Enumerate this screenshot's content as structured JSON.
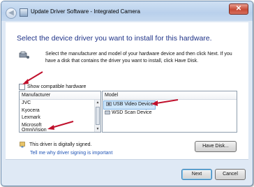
{
  "window": {
    "title": "Update Driver Software - Integrated Camera",
    "close_glyph": "✕",
    "back_glyph": "◀"
  },
  "content": {
    "heading": "Select the device driver you want to install for this hardware.",
    "instructions": "Select the manufacturer and model of your hardware device and then click Next. If you have a disk that contains the driver you want to install, click Have Disk.",
    "compatible_checkbox": {
      "label": "Show compatible hardware",
      "checked": false
    },
    "manufacturer_list": {
      "header": "Manufacturer",
      "items": [
        "JVC",
        "Kyocera",
        "Lexmark",
        "Microsoft",
        "OmniVision"
      ]
    },
    "model_list": {
      "header": "Model",
      "items": [
        "USB Video Device",
        "WSD Scan Device"
      ],
      "selected": "USB Video Device"
    },
    "signed_text": "This driver is digitally signed.",
    "signing_link": "Tell me why driver signing is important",
    "have_disk_label": "Have Disk..."
  },
  "footer": {
    "next_label": "Next",
    "cancel_label": "Cancel"
  },
  "colors": {
    "heading": "#1e3287",
    "link": "#1f54b6",
    "selection": "#cde6fb",
    "annotation_arrow": "#c0102c"
  },
  "icons": [
    "back-arrow-icon",
    "device-manager-icon",
    "hardware-icon",
    "camera-device-icon",
    "scanner-device-icon",
    "signed-driver-icon",
    "close-icon"
  ]
}
